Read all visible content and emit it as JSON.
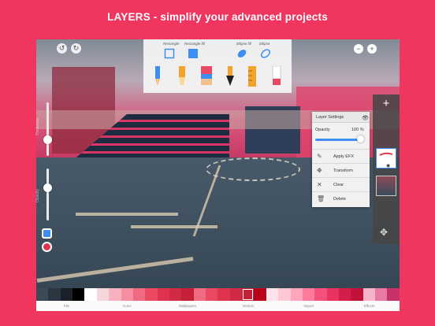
{
  "banner": {
    "title": "LAYERS  - simplify your advanced projects"
  },
  "toolpanel": {
    "shape_labels": [
      "Rectangle",
      "Rectangle fill",
      "Ellipse fill",
      "Ellipse"
    ],
    "brush_icons": [
      "pencil-icon",
      "marker-icon",
      "brush-icon",
      "pen-nib-icon",
      "ruler-icon",
      "eraser-icon"
    ]
  },
  "sliders": {
    "size_caption": "Thickness",
    "opacity_caption": "Opacity",
    "size_level": 0.3,
    "opacity_level": 0.45
  },
  "layer_settings": {
    "title": "Layer Settings",
    "opacity_label": "Opacity",
    "opacity_value": "100 %",
    "menu": [
      {
        "label": "Apply EFX",
        "icon": "pen-icon"
      },
      {
        "label": "Transform",
        "icon": "move-icon"
      },
      {
        "label": "Clear",
        "icon": "close-icon"
      },
      {
        "label": "Delete",
        "icon": "trash-icon"
      }
    ]
  },
  "tabs": [
    "File",
    "Icons",
    "Wallpapers",
    "Vectors",
    "Import",
    "Effects"
  ],
  "palette": [
    "#3c4a58",
    "#2b3642",
    "#1b2129",
    "#000000",
    "#ffffff",
    "#f4d6db",
    "#f7b2bf",
    "#f48ea0",
    "#f06a82",
    "#e94a62",
    "#e0334e",
    "#d12a44",
    "#c42139",
    "#f06a82",
    "#e94a62",
    "#e0334e",
    "#d12a44",
    "#c42139",
    "#b8001a",
    "#ffe3ea",
    "#ffc7d6",
    "#ffa5bc",
    "#ff7b9c",
    "#f4517a",
    "#e9325f",
    "#d41d49",
    "#c0123a",
    "#f7b4c8",
    "#e87aa2",
    "#c9316b"
  ],
  "selected_swatch": 17,
  "colors": {
    "accent": "#f0355e",
    "blue": "#3d8ef2"
  }
}
